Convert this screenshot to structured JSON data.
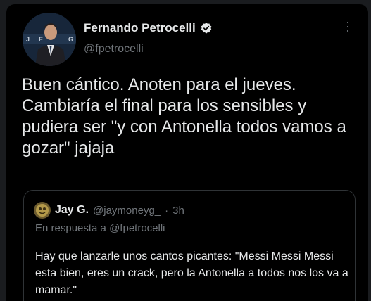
{
  "tweet": {
    "author": {
      "display_name": "Fernando Petrocelli",
      "handle": "@fpetrocelli",
      "verified": true,
      "avatar_logo_letters": [
        "J",
        "E",
        "G"
      ]
    },
    "text": "Buen cántico. Anoten para el jueves. Cambiaría el final para los sensibles y pudiera ser \"y con Antonella todos vamos a gozar\" jajaja",
    "more_icon": "more-vertical-icon"
  },
  "quoted_tweet": {
    "author": {
      "display_name": "Jay G.",
      "handle": "@jaymoneyg_",
      "separator": "·",
      "time": "3h"
    },
    "reply_context": {
      "prefix": "En respuesta a",
      "mention": "@fpetrocelli"
    },
    "text": "Hay que lanzarle unos cantos picantes: \"Messi Messi Messi esta bien, eres un crack, pero la Antonella a todos nos los va a mamar.\""
  },
  "colors": {
    "background": "#000000",
    "outer_background": "#1a1c1f",
    "primary_text": "#e7e9ea",
    "secondary_text": "#71767b",
    "border": "#2f3336",
    "verified_badge": "#e7e9ea"
  }
}
